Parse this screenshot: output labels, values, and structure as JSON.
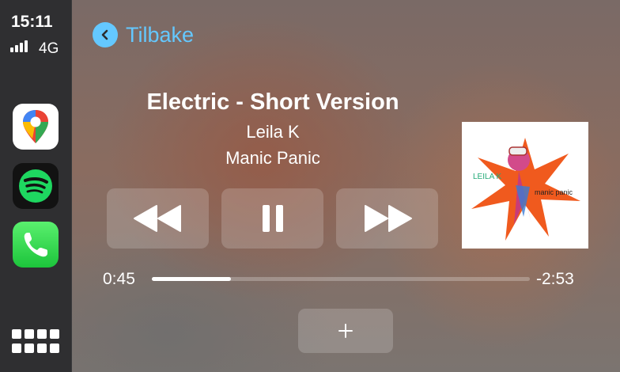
{
  "status": {
    "time": "15:11",
    "network": "4G",
    "signal_bars": 4
  },
  "dock": {
    "apps": [
      {
        "name": "Google Maps",
        "icon": "google-maps-icon"
      },
      {
        "name": "Spotify",
        "icon": "spotify-icon"
      },
      {
        "name": "Phone",
        "icon": "phone-icon"
      }
    ],
    "home_icon": "app-grid-icon"
  },
  "nav": {
    "back_label": "Tilbake"
  },
  "now_playing": {
    "title": "Electric - Short Version",
    "artist": "Leila K",
    "album": "Manic Panic",
    "elapsed": "0:45",
    "remaining": "-2:53",
    "progress_fraction": 0.21,
    "is_playing": true
  },
  "album_art": {
    "text": "LEILA K",
    "subtext": "manic panic"
  },
  "controls": {
    "rewind_icon": "rewind-icon",
    "pause_icon": "pause-icon",
    "fast_forward_icon": "fast-forward-icon",
    "add_icon": "plus-icon"
  },
  "colors": {
    "accent": "#64c8ff",
    "dock_bg": "#2f2f31",
    "spotify_green": "#1ed760",
    "phone_green": "#2fd24d",
    "art_orange": "#f05a1e"
  }
}
